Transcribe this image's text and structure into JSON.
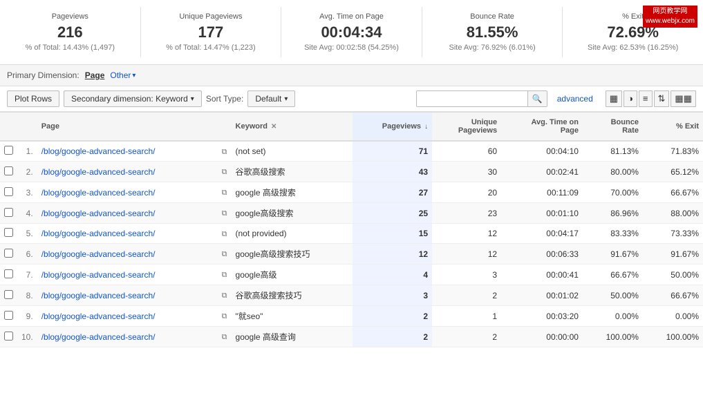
{
  "watermark": {
    "line1": "网页教学网",
    "line2": "www.webjx.com"
  },
  "stats": [
    {
      "label": "Pageviews",
      "value": "216",
      "sub": "% of Total: 14.43% (1,497)"
    },
    {
      "label": "Unique Pageviews",
      "value": "177",
      "sub": "% of Total: 14.47% (1,223)"
    },
    {
      "label": "Avg. Time on Page",
      "value": "00:04:34",
      "sub": "Site Avg: 00:02:58 (54.25%)"
    },
    {
      "label": "Bounce Rate",
      "value": "81.55%",
      "sub": "Site Avg: 76.92% (6.01%)"
    },
    {
      "label": "% Exit",
      "value": "72.69%",
      "sub": "Site Avg: 62.53% (16.25%)"
    }
  ],
  "primary_dim": {
    "label": "Primary Dimension:",
    "page_link": "Page",
    "other_label": "Other",
    "other_arrow": "▾"
  },
  "toolbar": {
    "plot_rows": "Plot Rows",
    "secondary_dim": "Secondary dimension: Keyword",
    "secondary_arrow": "▾",
    "sort_type_label": "Sort Type:",
    "sort_default": "Default",
    "sort_arrow": "▾",
    "search_placeholder": "",
    "advanced_label": "advanced"
  },
  "view_icons": [
    "▦",
    "◕",
    "≡",
    "⇅",
    "▦▦"
  ],
  "table": {
    "headers": [
      {
        "label": "",
        "key": "cb"
      },
      {
        "label": "",
        "key": "num"
      },
      {
        "label": "Page",
        "key": "page"
      },
      {
        "label": "",
        "key": "copy"
      },
      {
        "label": "Keyword",
        "key": "keyword",
        "filter": true
      },
      {
        "label": "Pageviews",
        "key": "pageviews",
        "sort": true
      },
      {
        "label": "Unique Pageviews",
        "key": "unique_pv"
      },
      {
        "label": "Avg. Time on Page",
        "key": "avg_time"
      },
      {
        "label": "Bounce Rate",
        "key": "bounce"
      },
      {
        "label": "% Exit",
        "key": "exit"
      }
    ],
    "rows": [
      {
        "num": 1,
        "page": "/blog/google-advanced-search/",
        "keyword": "(not set)",
        "pageviews": 71,
        "unique_pv": 60,
        "avg_time": "00:04:10",
        "bounce": "81.13%",
        "exit": "71.83%"
      },
      {
        "num": 2,
        "page": "/blog/google-advanced-search/",
        "keyword": "谷歌高级搜索",
        "pageviews": 43,
        "unique_pv": 30,
        "avg_time": "00:02:41",
        "bounce": "80.00%",
        "exit": "65.12%"
      },
      {
        "num": 3,
        "page": "/blog/google-advanced-search/",
        "keyword": "google 高级搜索",
        "pageviews": 27,
        "unique_pv": 20,
        "avg_time": "00:11:09",
        "bounce": "70.00%",
        "exit": "66.67%"
      },
      {
        "num": 4,
        "page": "/blog/google-advanced-search/",
        "keyword": "google高级搜索",
        "pageviews": 25,
        "unique_pv": 23,
        "avg_time": "00:01:10",
        "bounce": "86.96%",
        "exit": "88.00%"
      },
      {
        "num": 5,
        "page": "/blog/google-advanced-search/",
        "keyword": "(not provided)",
        "pageviews": 15,
        "unique_pv": 12,
        "avg_time": "00:04:17",
        "bounce": "83.33%",
        "exit": "73.33%"
      },
      {
        "num": 6,
        "page": "/blog/google-advanced-search/",
        "keyword": "google高级搜索技巧",
        "pageviews": 12,
        "unique_pv": 12,
        "avg_time": "00:06:33",
        "bounce": "91.67%",
        "exit": "91.67%"
      },
      {
        "num": 7,
        "page": "/blog/google-advanced-search/",
        "keyword": "google高级",
        "pageviews": 4,
        "unique_pv": 3,
        "avg_time": "00:00:41",
        "bounce": "66.67%",
        "exit": "50.00%"
      },
      {
        "num": 8,
        "page": "/blog/google-advanced-search/",
        "keyword": "谷歌高级搜索技巧",
        "pageviews": 3,
        "unique_pv": 2,
        "avg_time": "00:01:02",
        "bounce": "50.00%",
        "exit": "66.67%"
      },
      {
        "num": 9,
        "page": "/blog/google-advanced-search/",
        "keyword": "\"就seo\"",
        "pageviews": 2,
        "unique_pv": 1,
        "avg_time": "00:03:20",
        "bounce": "0.00%",
        "exit": "0.00%"
      },
      {
        "num": 10,
        "page": "/blog/google-advanced-search/",
        "keyword": "google 高级查询",
        "pageviews": 2,
        "unique_pv": 2,
        "avg_time": "00:00:00",
        "bounce": "100.00%",
        "exit": "100.00%"
      }
    ]
  }
}
